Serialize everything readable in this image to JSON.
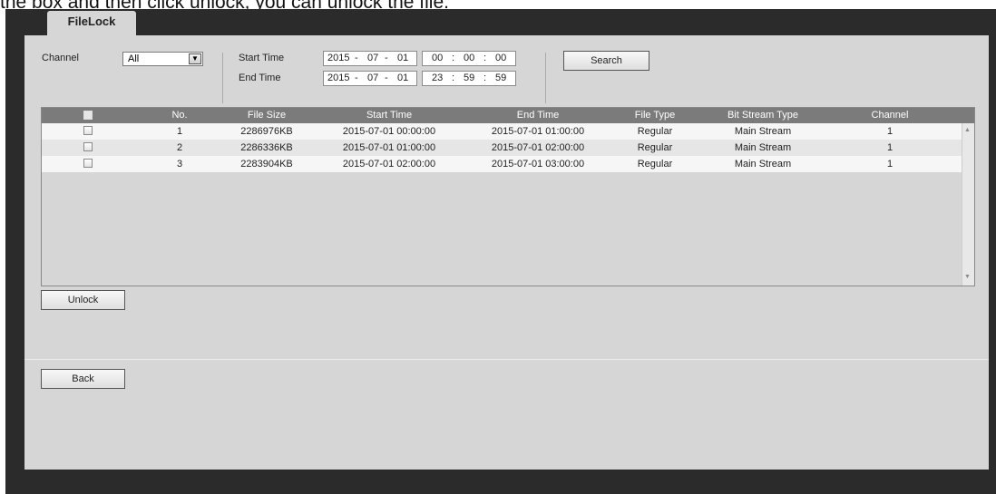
{
  "caption": "the box and then click unlock, you can unlock the file.",
  "tab_label": "FileLock",
  "filters": {
    "channel_label": "Channel",
    "channel_value": "All",
    "start_time_label": "Start Time",
    "end_time_label": "End Time",
    "start_date": {
      "year": "2015",
      "month": "07",
      "day": "01"
    },
    "start_clock": {
      "h": "00",
      "m": "00",
      "s": "00"
    },
    "end_date": {
      "year": "2015",
      "month": "07",
      "day": "01"
    },
    "end_clock": {
      "h": "23",
      "m": "59",
      "s": "59"
    },
    "date_sep": "-",
    "time_sep": ":",
    "search_label": "Search"
  },
  "table": {
    "headers": {
      "no": "No.",
      "file_size": "File Size",
      "start_time": "Start Time",
      "end_time": "End Time",
      "file_type": "File Type",
      "stream_type": "Bit Stream Type",
      "channel": "Channel"
    },
    "rows": [
      {
        "no": "1",
        "file_size": "2286976KB",
        "start_time": "2015-07-01 00:00:00",
        "end_time": "2015-07-01 01:00:00",
        "file_type": "Regular",
        "stream_type": "Main Stream",
        "channel": "1"
      },
      {
        "no": "2",
        "file_size": "2286336KB",
        "start_time": "2015-07-01 01:00:00",
        "end_time": "2015-07-01 02:00:00",
        "file_type": "Regular",
        "stream_type": "Main Stream",
        "channel": "1"
      },
      {
        "no": "3",
        "file_size": "2283904KB",
        "start_time": "2015-07-01 02:00:00",
        "end_time": "2015-07-01 03:00:00",
        "file_type": "Regular",
        "stream_type": "Main Stream",
        "channel": "1"
      }
    ]
  },
  "unlock_label": "Unlock",
  "back_label": "Back",
  "icons": {
    "dropdown": "chevron-down-icon",
    "scroll_up": "scroll-up-icon",
    "scroll_down": "scroll-down-icon"
  },
  "colors": {
    "panel_bg": "#d6d6d6",
    "frame_bg": "#2b2b2b",
    "header_bg": "#7b7b7b",
    "row_alt": "#e6e6e6",
    "row_white": "#f6f6f6"
  }
}
